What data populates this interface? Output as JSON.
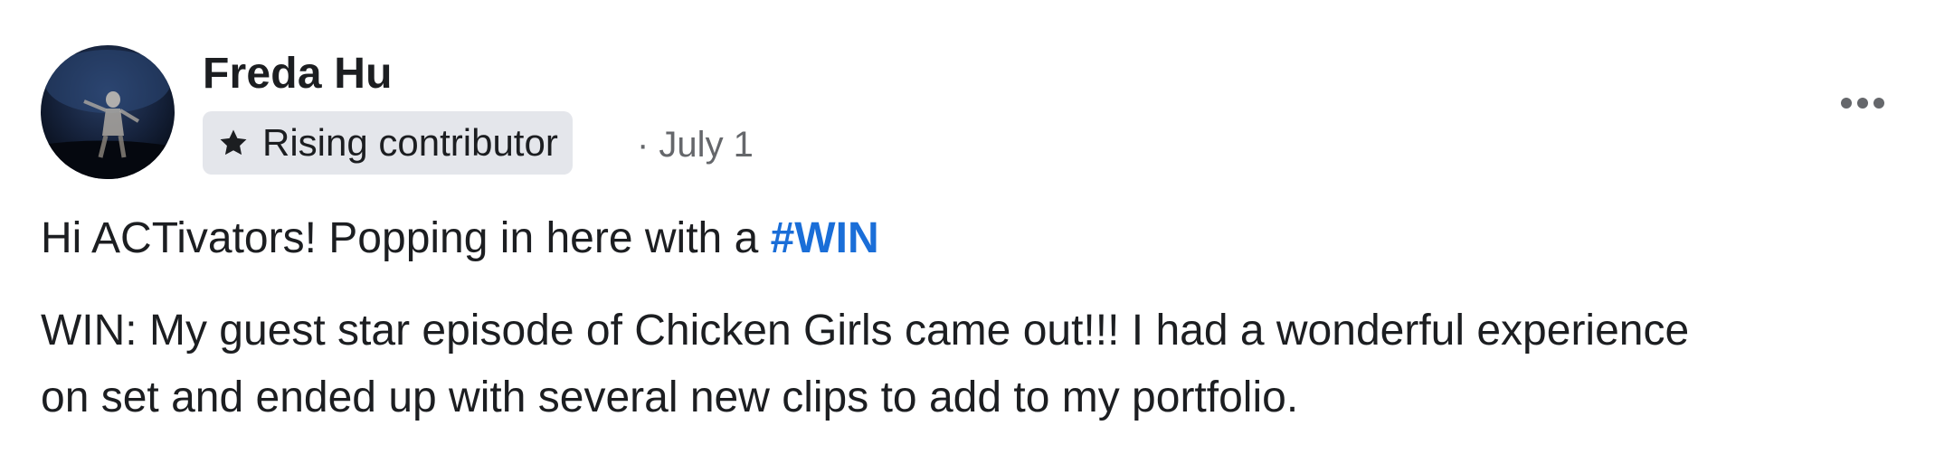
{
  "post": {
    "author": {
      "name": "Freda Hu",
      "badge": {
        "label": "Rising contributor",
        "icon": "star-icon"
      }
    },
    "meta": "· July 1",
    "more_icon": "more-horizontal-icon",
    "content": {
      "intro_text": "Hi ACTivators! Popping in here with a ",
      "hashtag": "#WIN",
      "paragraph_line1": "WIN: My guest star episode of Chicken Girls came out!!! I had a wonderful experience",
      "paragraph_line2": "on set and ended up with several new clips to add to my portfolio."
    }
  },
  "colors": {
    "text": "#1c1e21",
    "secondary_text": "#65676b",
    "link": "#1a6ed8",
    "badge_background": "#e4e6eb"
  }
}
